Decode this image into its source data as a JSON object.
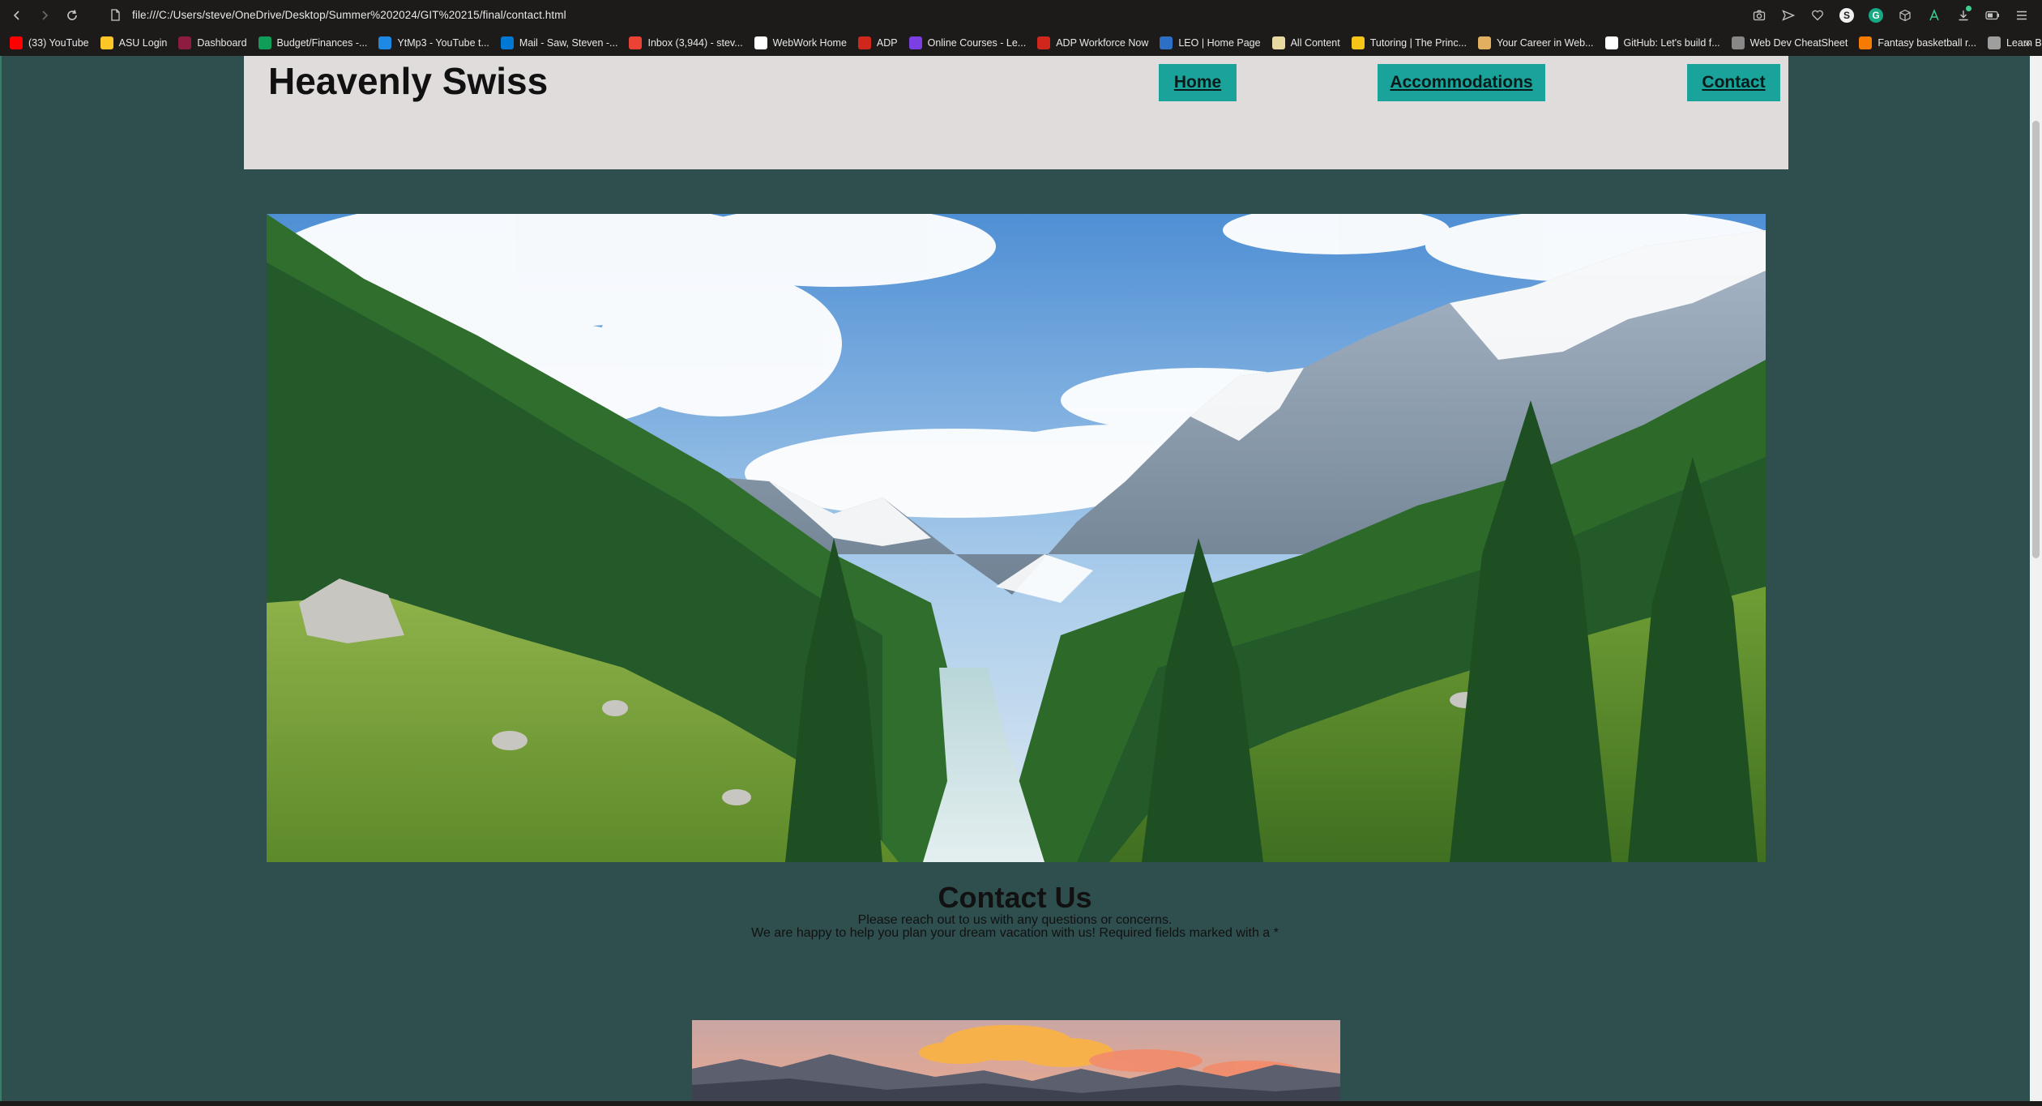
{
  "browser": {
    "url": "file:///C:/Users/steve/OneDrive/Desktop/Summer%202024/GIT%20215/final/contact.html",
    "bookmarks": [
      {
        "label": "(33) YouTube",
        "icon": "youtube-icon",
        "color": "#ff0000"
      },
      {
        "label": "ASU Login",
        "icon": "asu-icon",
        "color": "#ffc627"
      },
      {
        "label": "Dashboard",
        "icon": "asu-pitchfork-icon",
        "color": "#8c1d40"
      },
      {
        "label": "Budget/Finances -...",
        "icon": "sheets-icon",
        "color": "#0f9d58"
      },
      {
        "label": "YtMp3 - YouTube t...",
        "icon": "ytmp3-icon",
        "color": "#1e88e5"
      },
      {
        "label": "Mail - Saw, Steven -...",
        "icon": "outlook-icon",
        "color": "#0078d4"
      },
      {
        "label": "Inbox (3,944) - stev...",
        "icon": "gmail-icon",
        "color": "#ea4335"
      },
      {
        "label": "WebWork Home",
        "icon": "document-icon",
        "color": "#ffffff"
      },
      {
        "label": "ADP",
        "icon": "adp-icon",
        "color": "#d0271d"
      },
      {
        "label": "Online Courses - Le...",
        "icon": "courses-icon",
        "color": "#7b3fe4"
      },
      {
        "label": "ADP Workforce Now",
        "icon": "adp-icon",
        "color": "#d0271d"
      },
      {
        "label": "LEO | Home Page",
        "icon": "leo-icon",
        "color": "#2e6fc6"
      },
      {
        "label": "All Content",
        "icon": "content-icon",
        "color": "#e8d9a0"
      },
      {
        "label": "Tutoring | The Princ...",
        "icon": "princeton-icon",
        "color": "#f5c518"
      },
      {
        "label": "Your Career in Web...",
        "icon": "career-icon",
        "color": "#e0b060"
      },
      {
        "label": "GitHub: Let's build f...",
        "icon": "github-icon",
        "color": "#ffffff"
      },
      {
        "label": "Web Dev CheatSheet",
        "icon": "cheatsheet-icon",
        "color": "#888888"
      },
      {
        "label": "Fantasy basketball r...",
        "icon": "fantasy-icon",
        "color": "#f57c00"
      },
      {
        "label": "Learn Backend Dev...",
        "icon": "backend-icon",
        "color": "#9e9e9e"
      }
    ]
  },
  "site": {
    "title": "Heavenly Swiss",
    "nav": {
      "home": "Home",
      "accommodations": "Accommodations",
      "contact": "Contact"
    },
    "contact": {
      "heading": "Contact Us",
      "line1": "Please reach out to us with any questions or concerns.",
      "line2": "We are happy to help you plan your dream vacation with us! Required fields marked with a *"
    }
  },
  "colors": {
    "page_background": "#2f4f4f",
    "header_background": "#e0dcdc",
    "nav_button": "#19a39a"
  }
}
